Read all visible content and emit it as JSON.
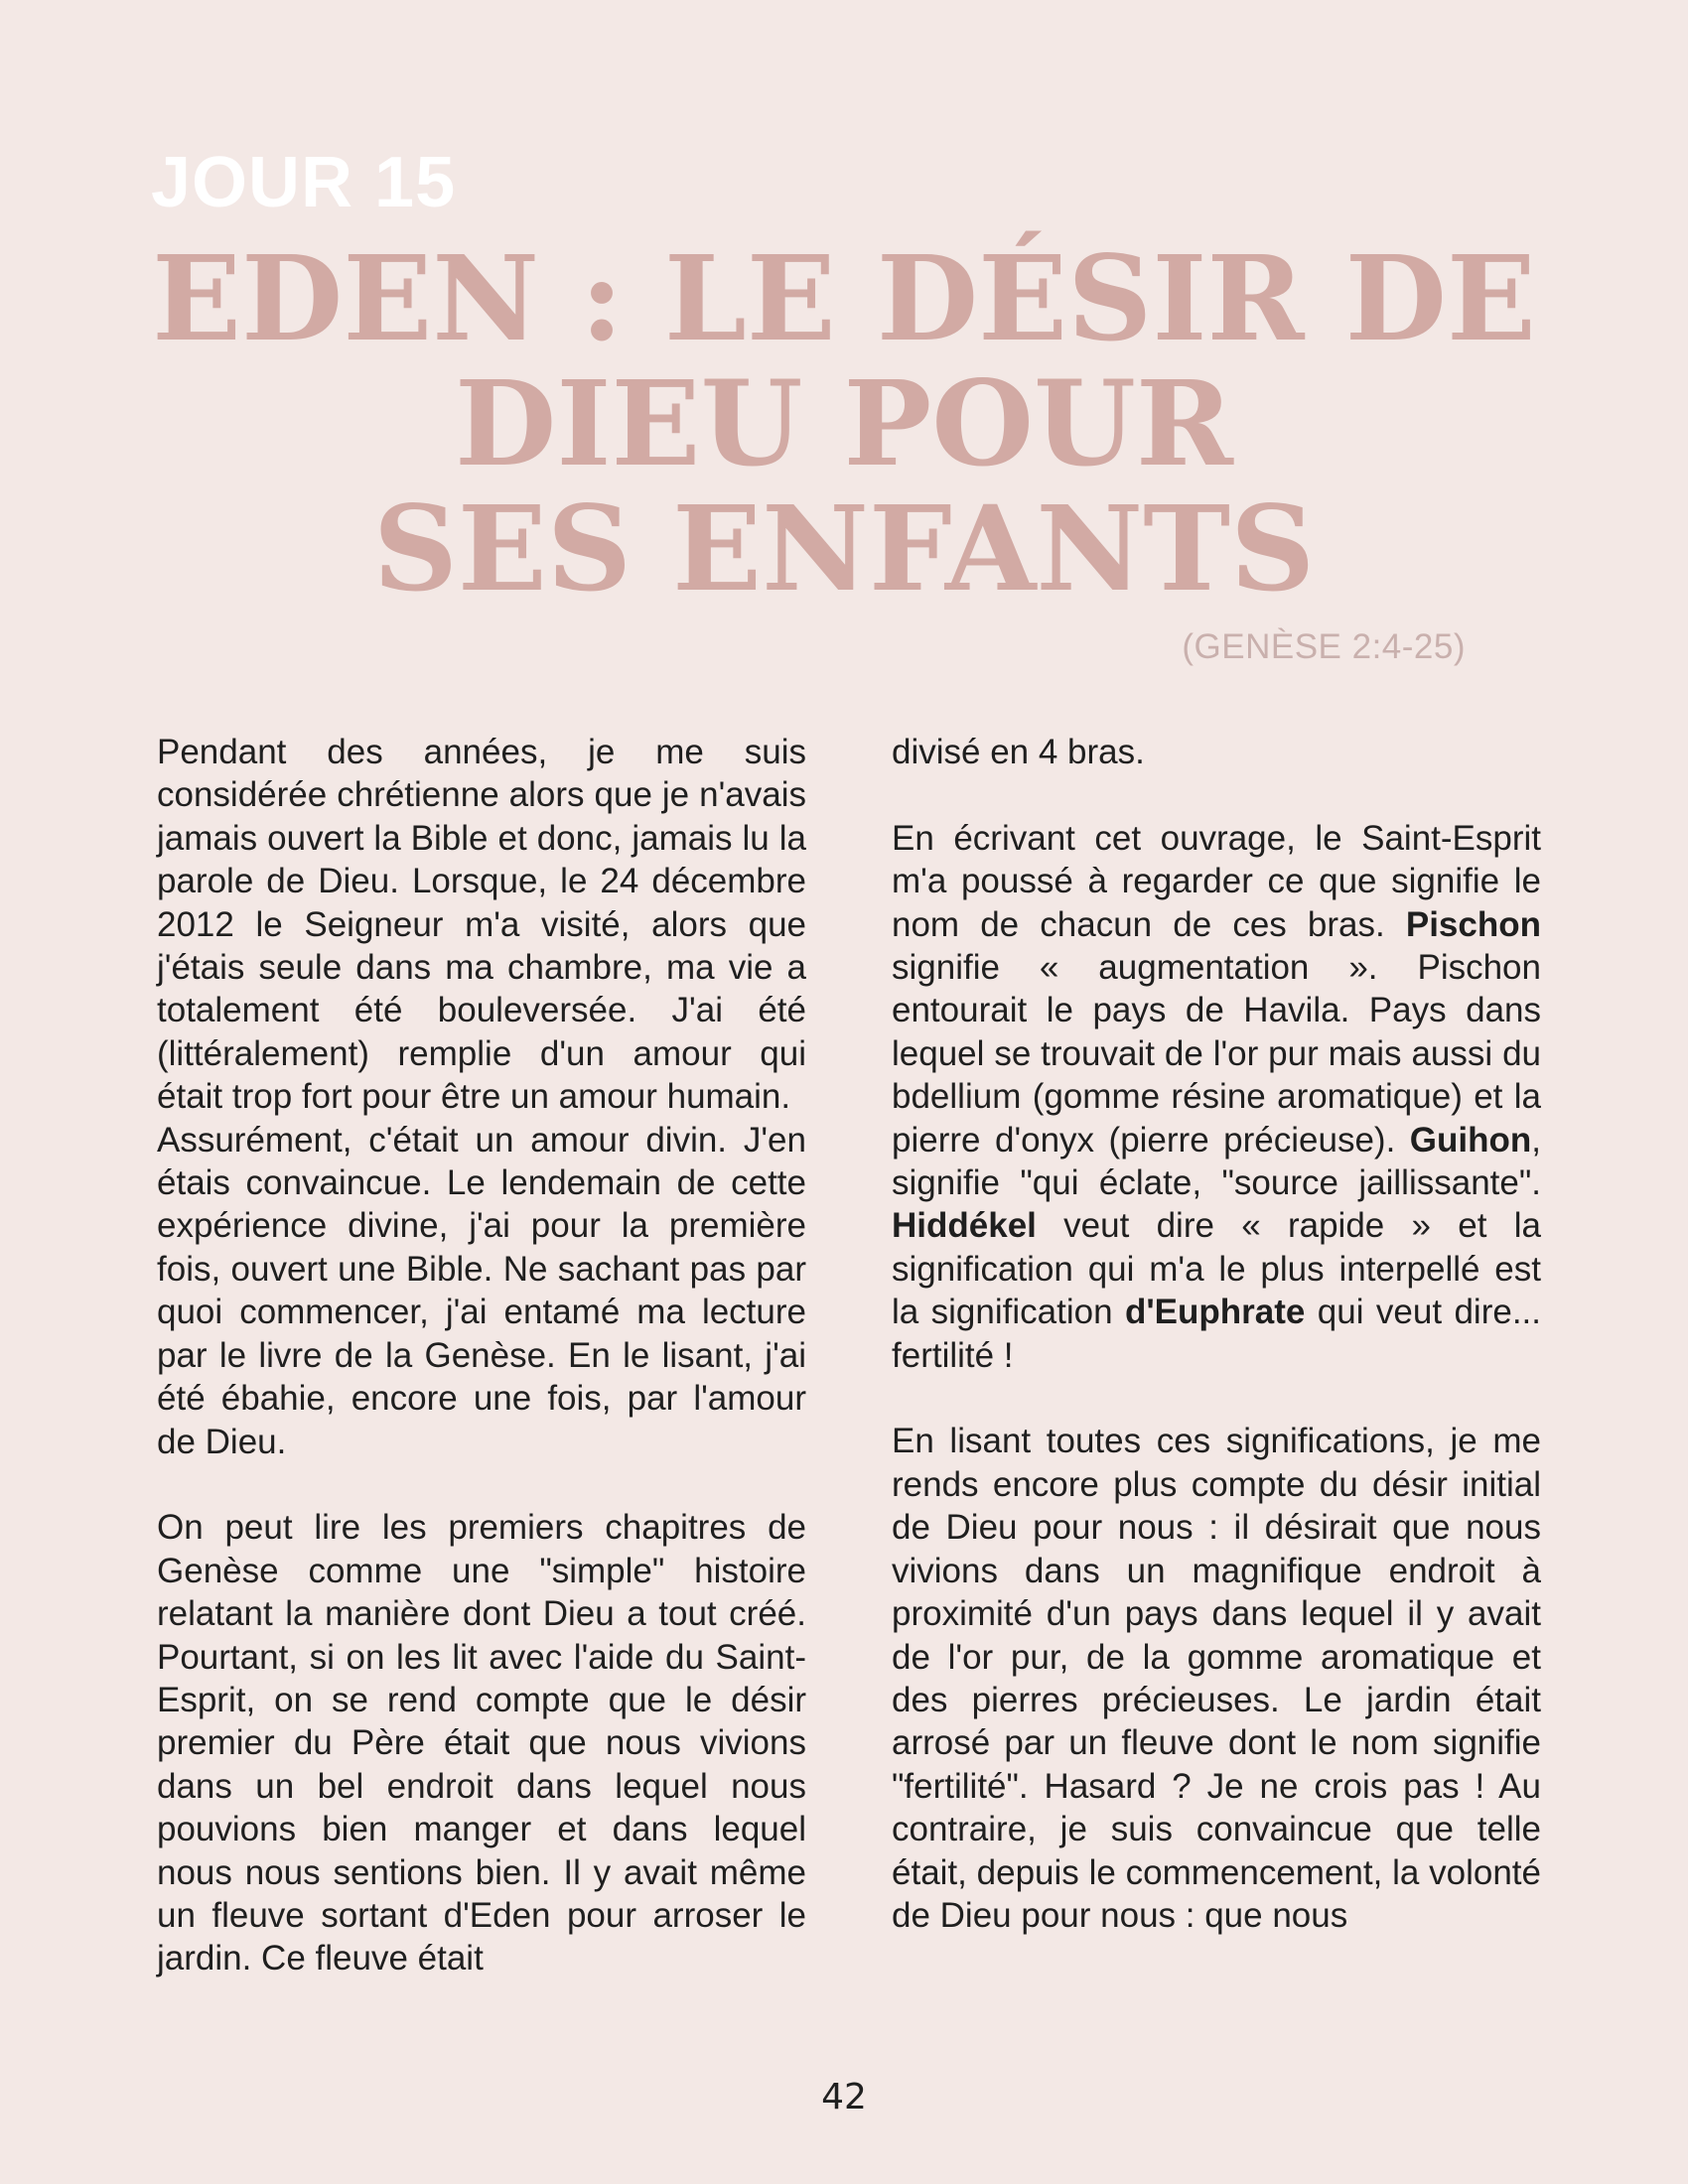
{
  "header": {
    "day_label": "JOUR 15",
    "title_lines": [
      "EDEN : LE DÉSIR DE",
      "DIEU POUR",
      "SES ENFANTS"
    ],
    "reference": "(GENÈSE 2:4-25)"
  },
  "left_column": {
    "p1": "Pendant des années, je me suis considérée chrétienne alors que je n'avais jamais ouvert la Bible et donc, jamais lu la parole de Dieu. Lorsque, le 24 décembre 2012 le Seigneur m'a visité, alors que j'étais seule dans ma chambre, ma vie a totalement été bouleversée. J'ai été (littéralement) remplie d'un amour qui était trop fort pour être un amour humain.",
    "p2": "Assurément, c'était un amour divin. J'en étais convaincue. Le lendemain de cette expérience divine, j'ai pour la première fois, ouvert une Bible. Ne sachant pas par quoi commencer, j'ai entamé ma lecture par le livre de la Genèse. En le lisant, j'ai été ébahie, encore une fois, par l'amour de Dieu.",
    "p3": "On peut lire les premiers chapitres de Genèse comme une \"simple\" histoire relatant la manière dont Dieu a tout créé. Pourtant, si on les lit avec l'aide du Saint-Esprit, on se rend compte que le désir premier du Père était que nous vivions dans un bel endroit dans lequel nous pouvions bien manger et dans lequel nous nous sentions bien. Il y avait même un fleuve sortant d'Eden pour arroser le jardin. Ce fleuve était"
  },
  "right_column": {
    "p1": "divisé en 4 bras.",
    "p2": {
      "t1": "En écrivant cet ouvrage, le Saint-Esprit m'a poussé à regarder ce que signifie le nom de chacun de ces bras. ",
      "b1": "Pischon",
      "t2": " signifie « augmentation ». Pischon entourait le pays de Havila. Pays dans lequel se trouvait de l'or pur mais aussi du bdellium (gomme résine aromatique) et la pierre d'onyx (pierre précieuse). ",
      "b2": "Guihon",
      "t3": ", signifie \"qui éclate, \"source jaillissante\". ",
      "b3": "Hiddékel",
      "t4": " veut dire « rapide » et la signification qui m'a le plus interpellé est la signification ",
      "b4": "d'Euphrate",
      "t5": " qui veut dire... fertilité !"
    },
    "p3": "En lisant toutes ces significations, je me rends encore plus compte du désir initial de Dieu pour nous : il désirait que nous vivions dans un magnifique endroit à proximité d'un pays dans lequel il y avait de l'or pur, de la gomme aromatique et des pierres précieuses. Le jardin était arrosé par un fleuve dont le nom signifie \"fertilité\". Hasard ? Je ne crois pas ! Au contraire, je suis convaincue que telle était, depuis le commencement, la volonté de Dieu pour nous : que nous"
  },
  "footer": {
    "page_number": "42"
  }
}
